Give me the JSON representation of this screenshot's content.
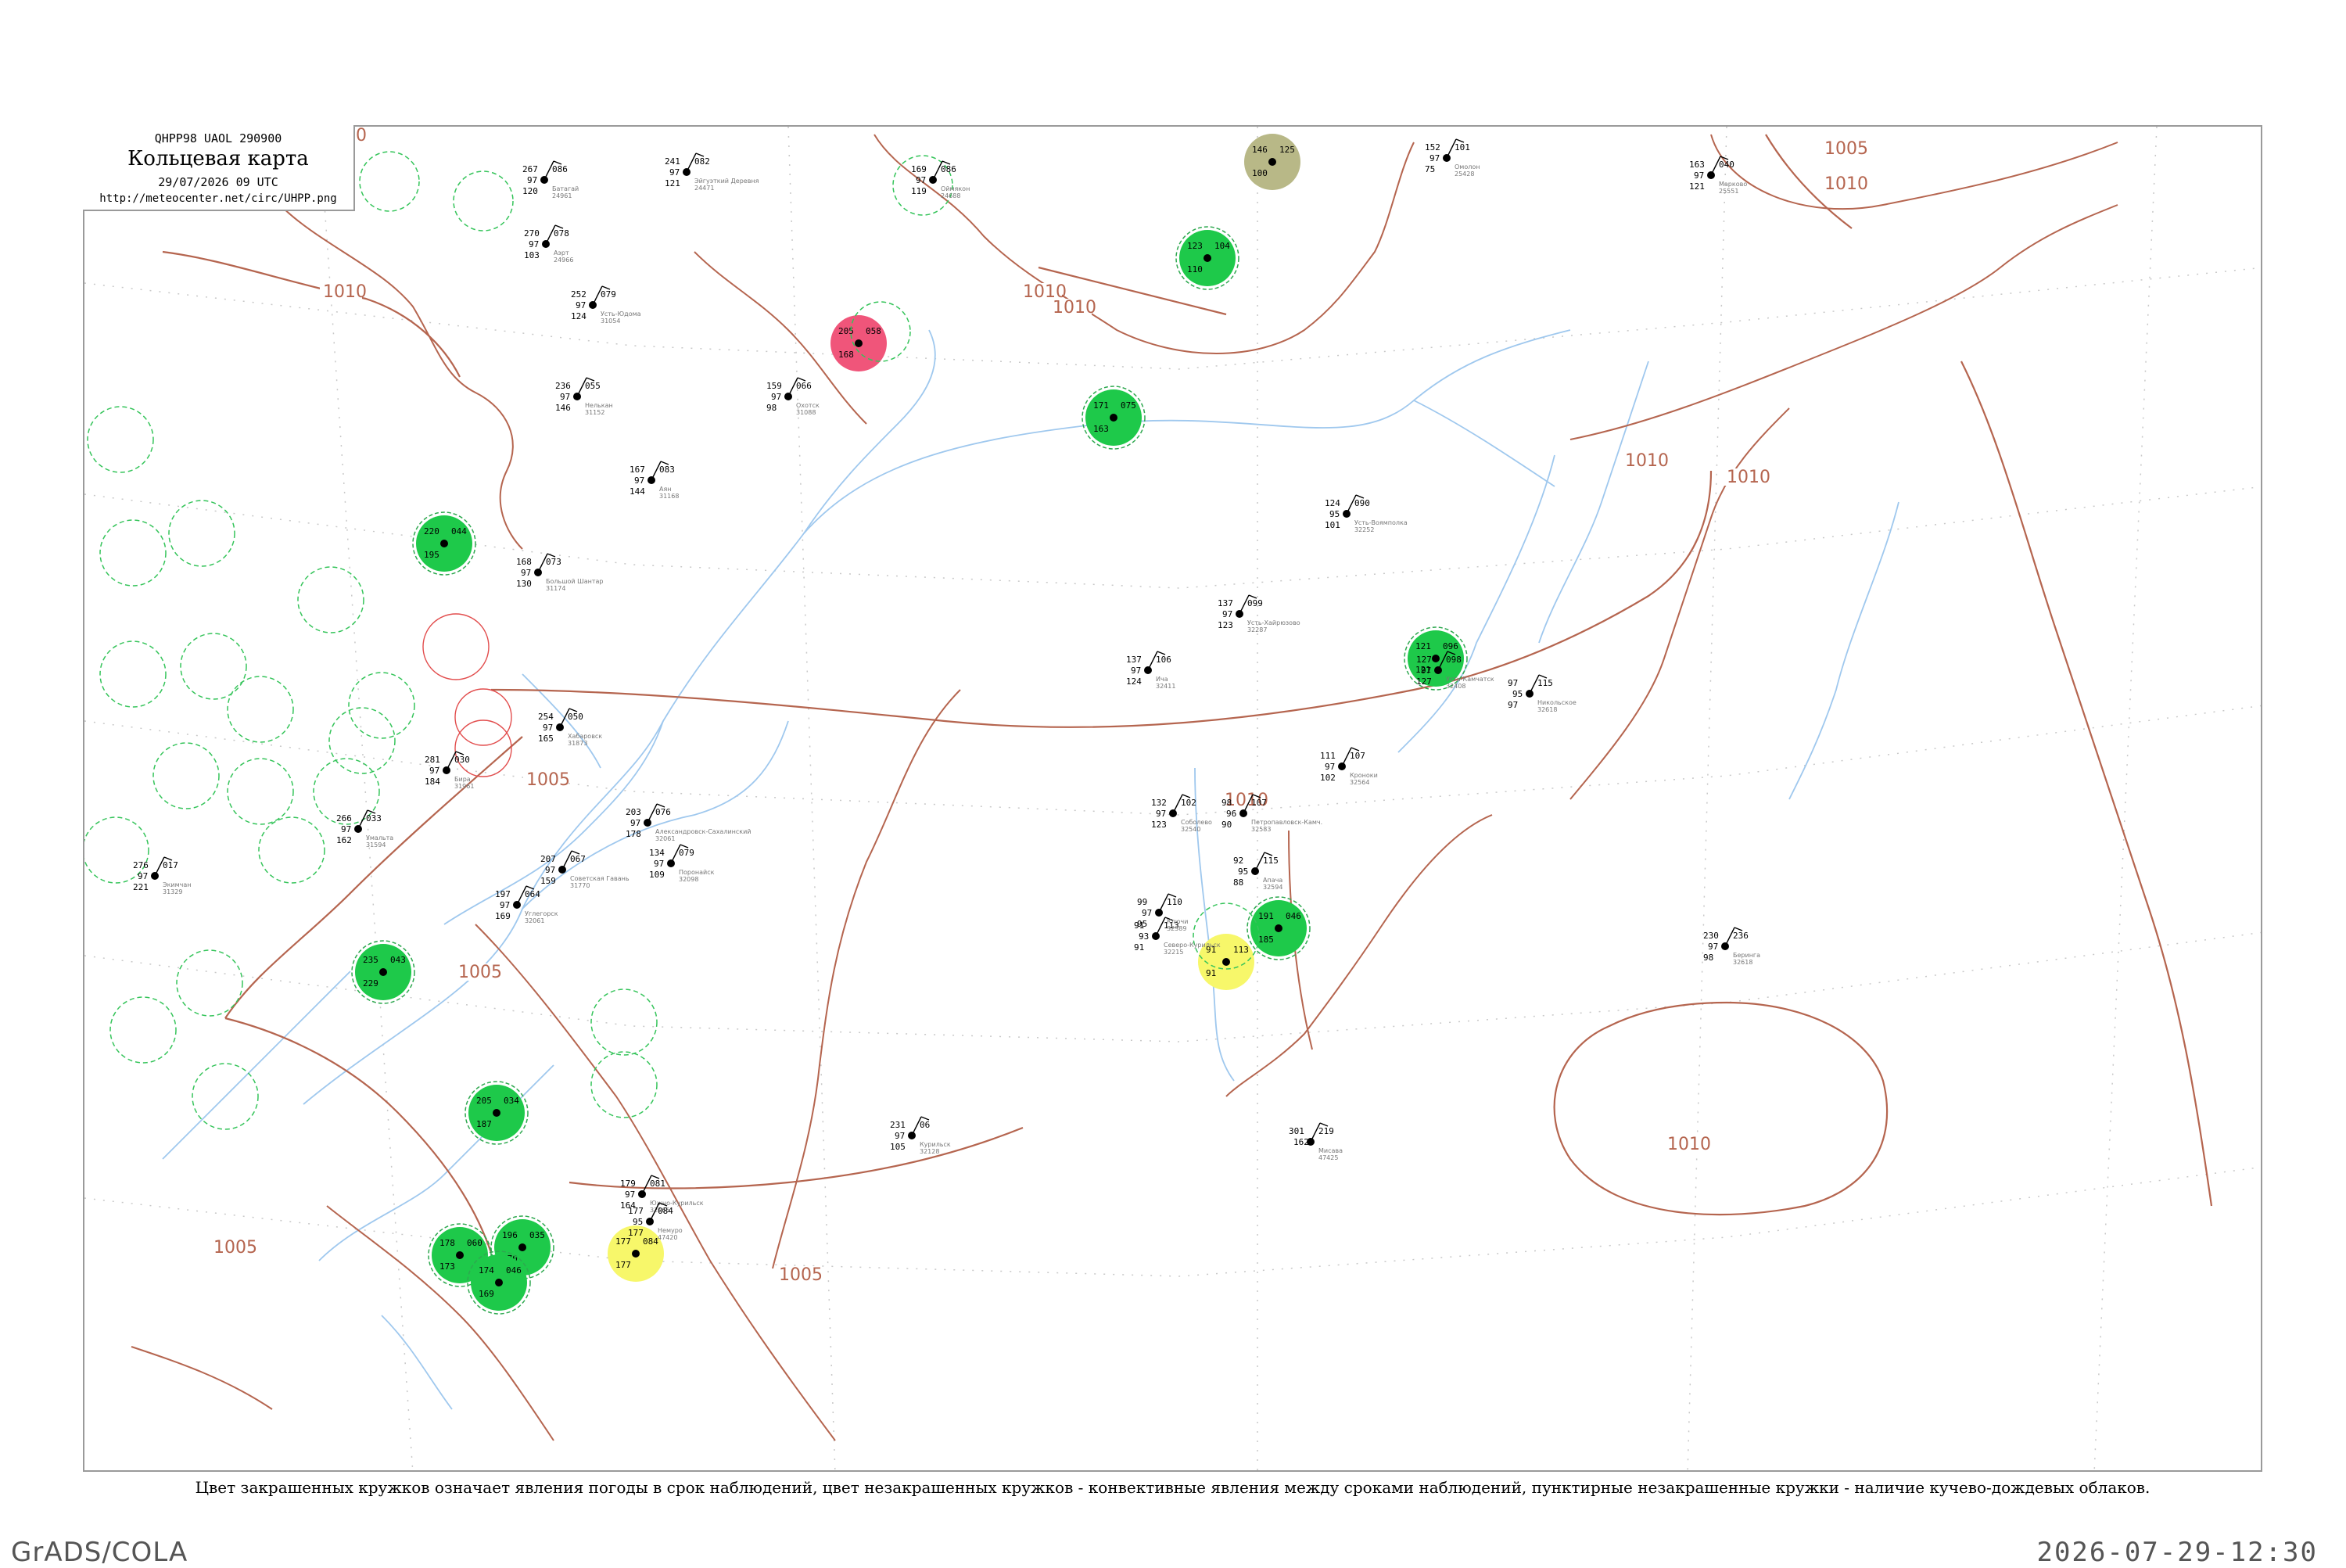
{
  "header": {
    "code": "QHPP98  UAOL  290900",
    "title": "Кольцевая карта",
    "datetime": "29/07/2026 09 UTC",
    "url": "http://meteocenter.net/circ/UHPP.png"
  },
  "caption": "Цвет закрашенных кружков означает явления погоды в срок наблюдений, цвет незакрашенных кружков - конвективные явления между сроками наблюдений, пунктирные незакрашенные кружки - наличие кучево-дождевых облаков.",
  "footer": {
    "left": "GrADS/COLA",
    "right": "2026-07-29-12:30"
  },
  "colors": {
    "coastline": "#b5654f",
    "river": "#9fc8ee",
    "isobar_label": "#b5654f",
    "green": "#1ec94a",
    "yellow": "#f7f76a",
    "khaki": "#b8b887",
    "red": "#f0557a"
  },
  "isobars": [
    {
      "value": "1010"
    },
    {
      "value": "1010"
    },
    {
      "value": "1010"
    },
    {
      "value": "1010"
    },
    {
      "value": "1005"
    },
    {
      "value": "1005"
    },
    {
      "value": "1005"
    },
    {
      "value": "1010"
    },
    {
      "value": "1010"
    },
    {
      "value": "1010"
    },
    {
      "value": "1010"
    },
    {
      "value": "1005"
    },
    {
      "value": "1005"
    },
    {
      "value": "1010"
    }
  ],
  "stations": [
    {
      "code": "24471",
      "name": "Эйгуэткий Деревня",
      "t": "241",
      "p": "082",
      "d": "97",
      "v": "121"
    },
    {
      "code": "24961",
      "name": "Батагай",
      "t": "267",
      "p": "086",
      "d": "97",
      "v": "120"
    },
    {
      "code": "24966",
      "name": "Аэрт",
      "t": "270",
      "p": "078",
      "d": "97",
      "v": "103"
    },
    {
      "code": "31054",
      "name": "Усть-Юдома",
      "t": "252",
      "p": "079",
      "d": "97",
      "v": "124"
    },
    {
      "code": "31152",
      "name": "Нелькан",
      "t": "236",
      "p": "055",
      "d": "97",
      "v": "146"
    },
    {
      "code": "31088",
      "name": "Охотск",
      "t": "159",
      "p": "066",
      "d": "97",
      "v": "98"
    },
    {
      "code": "31168",
      "name": "Аян",
      "t": "167",
      "p": "083",
      "d": "97",
      "v": "144"
    },
    {
      "code": "31174",
      "name": "Большой Шантар",
      "t": "168",
      "p": "073",
      "d": "97",
      "v": "130"
    },
    {
      "code": "24688",
      "name": "Оймякон",
      "t": "169",
      "p": "086",
      "d": "97",
      "v": "119"
    },
    {
      "code": "25428",
      "name": "Омолон",
      "t": "152",
      "p": "101",
      "d": "97",
      "v": "75"
    },
    {
      "code": "25551",
      "name": "Марково",
      "t": "163",
      "p": "040",
      "d": "97",
      "v": "121"
    },
    {
      "code": "32252",
      "name": "Усть-Воямполка",
      "t": "124",
      "p": "090",
      "d": "95",
      "v": "101"
    },
    {
      "code": "32287",
      "name": "Усть-Хайрюзово",
      "t": "137",
      "p": "099",
      "d": "97",
      "v": "123"
    },
    {
      "code": "32411",
      "name": "Ича",
      "t": "137",
      "p": "106",
      "d": "97",
      "v": "124"
    },
    {
      "code": "32408",
      "name": "Усть-Камчатск",
      "t": "127",
      "p": "098",
      "d": "97",
      "v": "127"
    },
    {
      "code": "32618",
      "name": "Никольское",
      "t": "97",
      "p": "115",
      "d": "95",
      "v": "97"
    },
    {
      "code": "32564",
      "name": "Кроноки",
      "t": "111",
      "p": "107",
      "d": "97",
      "v": "102"
    },
    {
      "code": "32583",
      "name": "Петропавловск-Камч.",
      "t": "98",
      "p": "107",
      "d": "96",
      "v": "90"
    },
    {
      "code": "32594",
      "name": "Апача",
      "t": "92",
      "p": "115",
      "d": "95",
      "v": "88"
    },
    {
      "code": "32215",
      "name": "Северо-Курильск",
      "t": "91",
      "p": "113",
      "d": "93",
      "v": "91"
    },
    {
      "code": "32540",
      "name": "Соболево",
      "t": "132",
      "p": "102",
      "d": "97",
      "v": "123"
    },
    {
      "code": "32389",
      "name": "Ключи",
      "t": "99",
      "p": "110",
      "d": "97",
      "v": "95"
    },
    {
      "code": "31961",
      "name": "Бира",
      "t": "281",
      "p": "030",
      "d": "97",
      "v": "184"
    },
    {
      "code": "31873",
      "name": "Хабаровск",
      "t": "254",
      "p": "050",
      "d": "97",
      "v": "165"
    },
    {
      "code": "32061",
      "name": "Александровск-Сахалинский",
      "t": "203",
      "p": "076",
      "d": "97",
      "v": "178"
    },
    {
      "code": "32098",
      "name": "Поронайск",
      "t": "134",
      "p": "079",
      "d": "97",
      "v": "109"
    },
    {
      "code": "32128",
      "name": "Курильск",
      "t": "231",
      "p": "06",
      "d": "97",
      "v": "105"
    },
    {
      "code": "32165",
      "name": "Южно-Курильск",
      "t": "179",
      "p": "081",
      "d": "97",
      "v": "164"
    },
    {
      "code": "47420",
      "name": "Немуро",
      "t": "177",
      "p": "084",
      "d": "95",
      "v": "177"
    },
    {
      "code": "32618B",
      "name": "Беринга",
      "t": "230",
      "p": "236",
      "d": "97",
      "v": "98"
    },
    {
      "code": "47425",
      "name": "Мисава",
      "t": "301",
      "p": "219",
      "d": "162",
      "v": ""
    },
    {
      "code": "31329",
      "name": "Экимчан",
      "t": "276",
      "p": "017",
      "d": "97",
      "v": "221"
    },
    {
      "code": "31594",
      "name": "Умальта",
      "t": "266",
      "p": "033",
      "d": "97",
      "v": "162"
    },
    {
      "code": "31770",
      "name": "Советская Гавань",
      "t": "207",
      "p": "067",
      "d": "97",
      "v": "159"
    },
    {
      "code": "32061B",
      "name": "Углегорск",
      "t": "197",
      "p": "064",
      "d": "97",
      "v": "169"
    }
  ],
  "circled_stations": [
    {
      "fill": "red",
      "t": "205",
      "p": "058",
      "v": "168"
    },
    {
      "fill": "green",
      "t": "123",
      "p": "104",
      "v": "110"
    },
    {
      "fill": "green",
      "t": "171",
      "p": "075",
      "v": "163"
    },
    {
      "fill": "green",
      "t": "121",
      "p": "096",
      "v": "121"
    },
    {
      "fill": "green",
      "t": "220",
      "p": "044",
      "v": "195"
    },
    {
      "fill": "green",
      "t": "235",
      "p": "043",
      "v": "229"
    },
    {
      "fill": "green",
      "t": "205",
      "p": "034",
      "v": "187"
    },
    {
      "fill": "green",
      "t": "178",
      "p": "060",
      "v": "173"
    },
    {
      "fill": "green",
      "t": "196",
      "p": "035",
      "v": "170"
    },
    {
      "fill": "green",
      "t": "174",
      "p": "046",
      "v": "169"
    },
    {
      "fill": "green",
      "t": "191",
      "p": "046",
      "v": "185"
    },
    {
      "fill": "khaki",
      "t": "146",
      "p": "125",
      "v": "100"
    },
    {
      "fill": "yellow",
      "t": "91",
      "p": "113",
      "v": "91"
    },
    {
      "fill": "yellow",
      "t": "177",
      "p": "084",
      "v": "177"
    }
  ]
}
